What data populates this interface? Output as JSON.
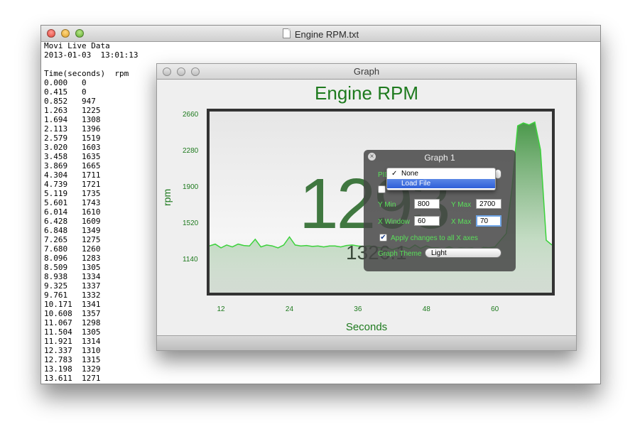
{
  "textedit": {
    "title": "Engine RPM.txt",
    "header_line1": "Movi Live Data",
    "header_line2": "2013-01-03  13:01:13",
    "col_header": "Time(seconds)  rpm",
    "rows": [
      [
        "0.000",
        "0"
      ],
      [
        "0.415",
        "0"
      ],
      [
        "0.852",
        "947"
      ],
      [
        "1.263",
        "1225"
      ],
      [
        "1.694",
        "1308"
      ],
      [
        "2.113",
        "1396"
      ],
      [
        "2.579",
        "1519"
      ],
      [
        "3.020",
        "1603"
      ],
      [
        "3.458",
        "1635"
      ],
      [
        "3.869",
        "1665"
      ],
      [
        "4.304",
        "1711"
      ],
      [
        "4.739",
        "1721"
      ],
      [
        "5.119",
        "1735"
      ],
      [
        "5.601",
        "1743"
      ],
      [
        "6.014",
        "1610"
      ],
      [
        "6.428",
        "1609"
      ],
      [
        "6.848",
        "1349"
      ],
      [
        "7.265",
        "1275"
      ],
      [
        "7.680",
        "1260"
      ],
      [
        "8.096",
        "1283"
      ],
      [
        "8.509",
        "1305"
      ],
      [
        "8.938",
        "1334"
      ],
      [
        "9.325",
        "1337"
      ],
      [
        "9.761",
        "1332"
      ],
      [
        "10.171",
        "1341"
      ],
      [
        "10.608",
        "1357"
      ],
      [
        "11.067",
        "1298"
      ],
      [
        "11.504",
        "1305"
      ],
      [
        "11.921",
        "1314"
      ],
      [
        "12.337",
        "1310"
      ],
      [
        "12.783",
        "1315"
      ],
      [
        "13.198",
        "1329"
      ],
      [
        "13.611",
        "1271"
      ]
    ]
  },
  "graph_window": {
    "title": "Graph",
    "big_value": "1293",
    "sub_value": "1326.1"
  },
  "chart_data": {
    "type": "area",
    "title": "Engine RPM",
    "xlabel": "Seconds",
    "ylabel": "rpm",
    "x_ticks": [
      "12",
      "24",
      "36",
      "48",
      "60"
    ],
    "y_ticks": [
      "2660",
      "2280",
      "1900",
      "1520",
      "1140"
    ],
    "xlim": [
      10,
      70
    ],
    "ylim": [
      800,
      2700
    ],
    "series_color": "#3cd23c",
    "x": [
      10,
      11,
      12,
      13,
      14,
      15,
      16,
      17,
      18,
      19,
      20,
      21,
      22,
      23,
      24,
      25,
      26,
      27,
      28,
      29,
      30,
      31,
      32,
      33,
      34,
      35,
      36,
      37,
      38,
      39,
      40,
      41,
      42,
      43,
      44,
      45,
      46,
      47,
      48,
      49,
      50,
      51,
      52,
      53,
      54,
      55,
      56,
      57,
      58,
      59,
      60,
      61,
      62,
      63,
      64,
      65,
      66,
      67,
      68,
      69,
      70
    ],
    "values": [
      1290,
      1310,
      1270,
      1300,
      1280,
      1310,
      1295,
      1290,
      1360,
      1280,
      1300,
      1290,
      1270,
      1300,
      1385,
      1300,
      1290,
      1295,
      1285,
      1290,
      1280,
      1290,
      1290,
      1280,
      1295,
      1300,
      1290,
      1285,
      1290,
      1280,
      1270,
      1275,
      1250,
      1270,
      1280,
      1260,
      1300,
      1265,
      1290,
      1270,
      1270,
      1260,
      1280,
      1260,
      1270,
      1265,
      1270,
      1250,
      1275,
      1270,
      1280,
      1350,
      1420,
      1900,
      2550,
      2580,
      2560,
      2590,
      2300,
      1350,
      1300
    ]
  },
  "hud": {
    "title": "Graph 1",
    "pid_label": "PID",
    "dropdown_items": [
      "None",
      "Load File"
    ],
    "ymin_label": "Y Min",
    "ymin_value": "800",
    "ymax_label": "Y Max",
    "ymax_value": "2700",
    "xwindow_label": "X Window",
    "xwindow_value": "60",
    "xmax_label": "X Max",
    "xmax_value": "70",
    "apply_label": "Apply changes to all X axes",
    "theme_label": "Graph Theme",
    "theme_value": "Light"
  }
}
